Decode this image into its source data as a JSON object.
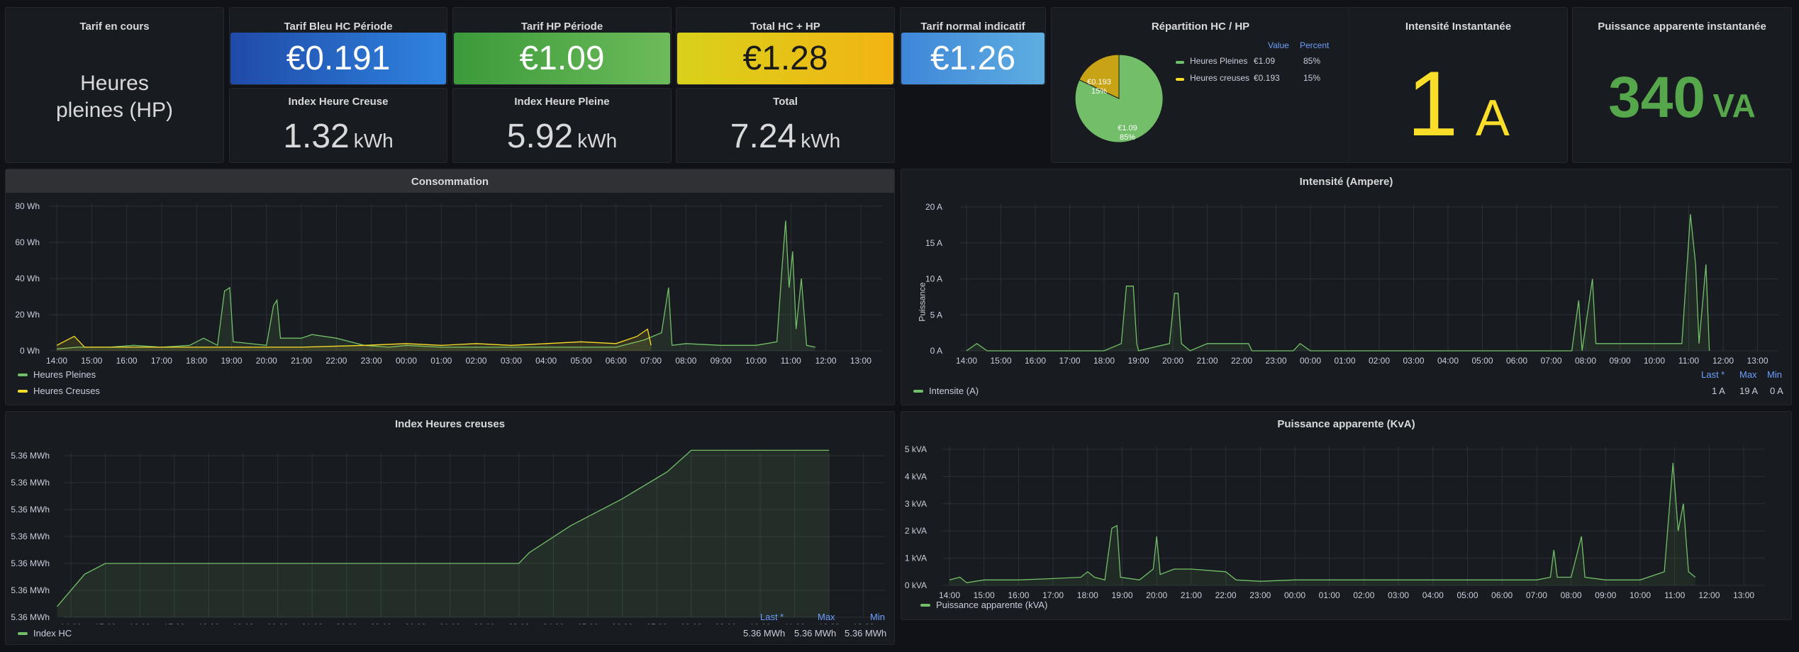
{
  "colors": {
    "green": "#73bf69",
    "yellow": "#fade2a",
    "hp_green": "#56a64b",
    "blue": "#5794f2"
  },
  "tarif_en_cours": {
    "title": "Tarif en cours",
    "value": "Heures pleines (HP)"
  },
  "tarif_bleu_hc": {
    "title": "Tarif Bleu HC Période",
    "value": "€0.191"
  },
  "tarif_hp": {
    "title": "Tarif HP Période",
    "value": "€1.09"
  },
  "total_hc_hp": {
    "title": "Total HC + HP",
    "value": "€1.28"
  },
  "tarif_normal": {
    "title": "Tarif normal indicatif",
    "value": "€1.26"
  },
  "index_hc": {
    "title": "Index Heure Creuse",
    "value": "1.32",
    "unit": "kWh"
  },
  "index_hp": {
    "title": "Index Heure Pleine",
    "value": "5.92",
    "unit": "kWh"
  },
  "index_total": {
    "title": "Total",
    "value": "7.24",
    "unit": "kWh"
  },
  "repartition": {
    "title": "Répartition HC / HP",
    "hdr_value": "Value",
    "hdr_percent": "Percent",
    "rows": [
      {
        "name": "Heures Pleines",
        "value": "€1.09",
        "percent": "85%"
      },
      {
        "name": "Heures creuses",
        "value": "€0.193",
        "percent": "15%"
      }
    ],
    "slice_labels": [
      {
        "value": "€1.09",
        "percent": "85%"
      },
      {
        "value": "€0.193",
        "percent": "15%"
      }
    ]
  },
  "intensite_inst": {
    "title": "Intensité Instantanée",
    "value": "1",
    "unit": "A"
  },
  "puissance_inst": {
    "title": "Puissance apparente instantanée",
    "value": "340",
    "unit": "VA"
  },
  "conso": {
    "title": "Consommation",
    "legend": [
      "Heures Pleines",
      "Heures Creuses"
    ]
  },
  "intensite": {
    "title": "Intensité (Ampere)",
    "ylabel": "Puissance",
    "legend": "Intensite (A)",
    "hdr": [
      "Last *",
      "Max",
      "Min"
    ],
    "vals": [
      "1 A",
      "19 A",
      "0 A"
    ]
  },
  "index_chart": {
    "title": "Index Heures creuses",
    "legend": "Index HC",
    "hdr": [
      "Last *",
      "Max",
      "Min"
    ],
    "vals": [
      "5.36 MWh",
      "5.36 MWh",
      "5.36 MWh"
    ]
  },
  "puissance": {
    "title": "Puissance apparente (KvA)",
    "legend": "Puissance apparente (kVA)"
  },
  "chart_data": [
    {
      "type": "area",
      "title": "Consommation",
      "x": [
        "14:00",
        "15:00",
        "16:00",
        "17:00",
        "18:00",
        "19:00",
        "20:00",
        "21:00",
        "22:00",
        "23:00",
        "00:00",
        "01:00",
        "02:00",
        "03:00",
        "04:00",
        "05:00",
        "06:00",
        "07:00",
        "08:00",
        "09:00",
        "10:00",
        "11:00",
        "12:00",
        "13:00"
      ],
      "ytick_labels": [
        "0 Wh",
        "20 Wh",
        "40 Wh",
        "60 Wh",
        "80 Wh"
      ],
      "ylim": [
        0,
        80
      ],
      "series": [
        {
          "name": "Heures Pleines",
          "color": "#73bf69",
          "points": [
            [
              0,
              1
            ],
            [
              0.6,
              2
            ],
            [
              1.5,
              2
            ],
            [
              2.2,
              3
            ],
            [
              3,
              2
            ],
            [
              3.8,
              3
            ],
            [
              4.2,
              7
            ],
            [
              4.6,
              3
            ],
            [
              4.8,
              33
            ],
            [
              4.95,
              35
            ],
            [
              5.05,
              5
            ],
            [
              6,
              3
            ],
            [
              6.2,
              25
            ],
            [
              6.3,
              28
            ],
            [
              6.4,
              7
            ],
            [
              7,
              7
            ],
            [
              7.3,
              9
            ],
            [
              8,
              7
            ],
            [
              8.8,
              3
            ],
            [
              9.5,
              2
            ],
            [
              10,
              3
            ],
            [
              11,
              2
            ],
            [
              12,
              2
            ],
            [
              13,
              2
            ],
            [
              14,
              2
            ],
            [
              15,
              2
            ],
            [
              16,
              2
            ],
            [
              16.8,
              6
            ],
            [
              17.3,
              10
            ],
            [
              17.5,
              35
            ],
            [
              17.6,
              3
            ],
            [
              18,
              4
            ],
            [
              19,
              3
            ],
            [
              20,
              3
            ],
            [
              20.6,
              5
            ],
            [
              20.75,
              47
            ],
            [
              20.85,
              72
            ],
            [
              20.95,
              35
            ],
            [
              21.05,
              55
            ],
            [
              21.15,
              12
            ],
            [
              21.3,
              40
            ],
            [
              21.45,
              3
            ],
            [
              21.7,
              2
            ]
          ]
        },
        {
          "name": "Heures Creuses",
          "color": "#fade2a",
          "points": [
            [
              0,
              3
            ],
            [
              0.5,
              8
            ],
            [
              0.8,
              2
            ],
            [
              1.5,
              2
            ],
            [
              3.5,
              2
            ],
            [
              5,
              2
            ],
            [
              7,
              2
            ],
            [
              8.8,
              3
            ],
            [
              10,
              4
            ],
            [
              11,
              3
            ],
            [
              12,
              4
            ],
            [
              13,
              3
            ],
            [
              14,
              4
            ],
            [
              15,
              5
            ],
            [
              16,
              4
            ],
            [
              16.6,
              8
            ],
            [
              16.9,
              12
            ],
            [
              17.0,
              3
            ]
          ]
        }
      ]
    },
    {
      "type": "line",
      "title": "Intensité (Ampere)",
      "x": [
        "14:00",
        "15:00",
        "16:00",
        "17:00",
        "18:00",
        "19:00",
        "20:00",
        "21:00",
        "22:00",
        "23:00",
        "00:00",
        "01:00",
        "02:00",
        "03:00",
        "04:00",
        "05:00",
        "06:00",
        "07:00",
        "08:00",
        "09:00",
        "10:00",
        "11:00",
        "12:00",
        "13:00"
      ],
      "ytick_labels": [
        "0 A",
        "5 A",
        "10 A",
        "15 A",
        "20 A"
      ],
      "ylim": [
        0,
        20
      ],
      "series": [
        {
          "name": "Intensite (A)",
          "color": "#73bf69",
          "points": [
            [
              0,
              0
            ],
            [
              0.3,
              1
            ],
            [
              0.6,
              0
            ],
            [
              4,
              0
            ],
            [
              4.5,
              1
            ],
            [
              4.65,
              9
            ],
            [
              4.85,
              9
            ],
            [
              4.95,
              1
            ],
            [
              5,
              0
            ],
            [
              5.9,
              1
            ],
            [
              6.05,
              8
            ],
            [
              6.15,
              8
            ],
            [
              6.25,
              1
            ],
            [
              6.5,
              0
            ],
            [
              7,
              1
            ],
            [
              8.2,
              1
            ],
            [
              8.3,
              0
            ],
            [
              9.5,
              0
            ],
            [
              9.7,
              1
            ],
            [
              10,
              0
            ],
            [
              17.6,
              0
            ],
            [
              17.8,
              7
            ],
            [
              17.9,
              0
            ],
            [
              18.2,
              10
            ],
            [
              18.3,
              1
            ],
            [
              20.8,
              1
            ],
            [
              21.05,
              19
            ],
            [
              21.2,
              12
            ],
            [
              21.3,
              1
            ],
            [
              21.5,
              12
            ],
            [
              21.6,
              0
            ]
          ]
        }
      ]
    },
    {
      "type": "area",
      "title": "Index Heures creuses",
      "x": [
        "14:00",
        "15:00",
        "16:00",
        "17:00",
        "18:00",
        "19:00",
        "20:00",
        "21:00",
        "22:00",
        "23:00",
        "00:00",
        "01:00",
        "02:00",
        "03:00",
        "04:00",
        "05:00",
        "06:00",
        "07:00",
        "08:00",
        "09:00",
        "10:00",
        "11:00",
        "12:00",
        "13:00"
      ],
      "ytick_labels": [
        "5.36 MWh",
        "5.36 MWh",
        "5.36 MWh",
        "5.36 MWh",
        "5.36 MWh",
        "5.36 MWh",
        "5.36 MWh"
      ],
      "series": [
        {
          "name": "Index HC",
          "color": "#73bf69",
          "points": [
            [
              -0.4,
              0.4
            ],
            [
              0.4,
              1.6
            ],
            [
              1.0,
              2.0
            ],
            [
              13.0,
              2.0
            ],
            [
              13.3,
              2.4
            ],
            [
              14.5,
              3.4
            ],
            [
              16.0,
              4.4
            ],
            [
              17.3,
              5.4
            ],
            [
              18.0,
              6.2
            ],
            [
              22.0,
              6.2
            ]
          ]
        }
      ]
    },
    {
      "type": "line",
      "title": "Puissance apparente (KvA)",
      "x": [
        "14:00",
        "15:00",
        "16:00",
        "17:00",
        "18:00",
        "19:00",
        "20:00",
        "21:00",
        "22:00",
        "23:00",
        "00:00",
        "01:00",
        "02:00",
        "03:00",
        "04:00",
        "05:00",
        "06:00",
        "07:00",
        "08:00",
        "09:00",
        "10:00",
        "11:00",
        "12:00",
        "13:00"
      ],
      "ytick_labels": [
        "0 kVA",
        "1 kVA",
        "2 kVA",
        "3 kVA",
        "4 kVA",
        "5 kVA"
      ],
      "ylim": [
        0,
        5
      ],
      "series": [
        {
          "name": "Puissance apparente (kVA)",
          "color": "#73bf69",
          "points": [
            [
              0,
              0.2
            ],
            [
              0.3,
              0.3
            ],
            [
              0.5,
              0.1
            ],
            [
              1,
              0.2
            ],
            [
              2,
              0.2
            ],
            [
              3,
              0.25
            ],
            [
              3.8,
              0.3
            ],
            [
              4.0,
              0.5
            ],
            [
              4.2,
              0.3
            ],
            [
              4.5,
              0.2
            ],
            [
              4.7,
              2.1
            ],
            [
              4.85,
              2.2
            ],
            [
              4.95,
              0.3
            ],
            [
              5.5,
              0.2
            ],
            [
              5.9,
              0.6
            ],
            [
              6.0,
              1.8
            ],
            [
              6.1,
              0.4
            ],
            [
              6.5,
              0.6
            ],
            [
              7,
              0.6
            ],
            [
              8,
              0.5
            ],
            [
              8.3,
              0.2
            ],
            [
              9,
              0.15
            ],
            [
              10,
              0.2
            ],
            [
              11,
              0.2
            ],
            [
              12,
              0.2
            ],
            [
              13,
              0.2
            ],
            [
              14,
              0.2
            ],
            [
              15,
              0.2
            ],
            [
              16,
              0.2
            ],
            [
              17,
              0.2
            ],
            [
              17.4,
              0.3
            ],
            [
              17.5,
              1.3
            ],
            [
              17.6,
              0.3
            ],
            [
              18,
              0.3
            ],
            [
              18.3,
              1.8
            ],
            [
              18.4,
              0.3
            ],
            [
              19,
              0.2
            ],
            [
              20,
              0.2
            ],
            [
              20.7,
              0.5
            ],
            [
              20.95,
              4.5
            ],
            [
              21.1,
              2.0
            ],
            [
              21.25,
              3.0
            ],
            [
              21.4,
              0.5
            ],
            [
              21.6,
              0.3
            ]
          ]
        }
      ]
    }
  ]
}
